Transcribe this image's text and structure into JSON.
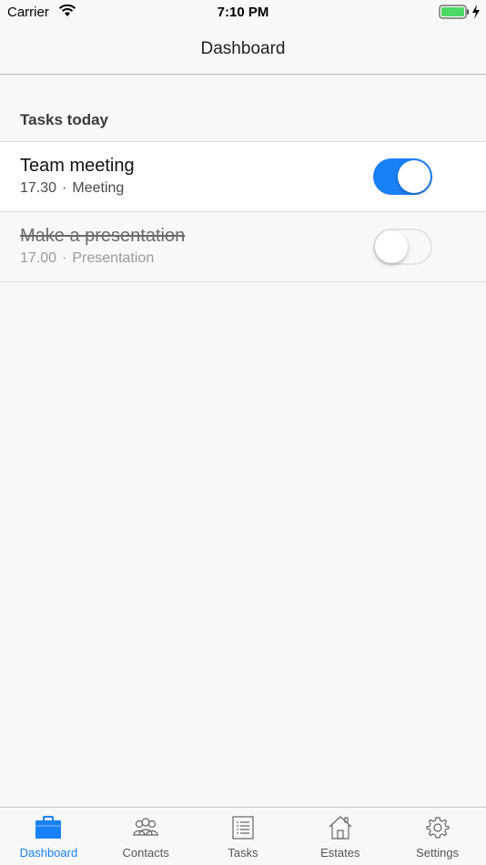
{
  "status_bar": {
    "carrier": "Carrier",
    "time": "7:10 PM",
    "battery_color": "#4cd964"
  },
  "nav": {
    "title": "Dashboard"
  },
  "section": {
    "title": "Tasks today"
  },
  "tasks": [
    {
      "title": "Team meeting",
      "time": "17.30",
      "category": "Meeting",
      "enabled": true,
      "completed": false
    },
    {
      "title": "Make a presentation",
      "time": "17.00",
      "category": "Presentation",
      "enabled": false,
      "completed": true
    }
  ],
  "meta_separator": "·",
  "tab_bar": {
    "accent_color": "#1a80f6",
    "tabs": [
      {
        "label": "Dashboard",
        "icon": "briefcase-icon",
        "selected": true
      },
      {
        "label": "Contacts",
        "icon": "people-icon",
        "selected": false
      },
      {
        "label": "Tasks",
        "icon": "list-icon",
        "selected": false
      },
      {
        "label": "Estates",
        "icon": "house-icon",
        "selected": false
      },
      {
        "label": "Settings",
        "icon": "gear-icon",
        "selected": false
      }
    ]
  }
}
